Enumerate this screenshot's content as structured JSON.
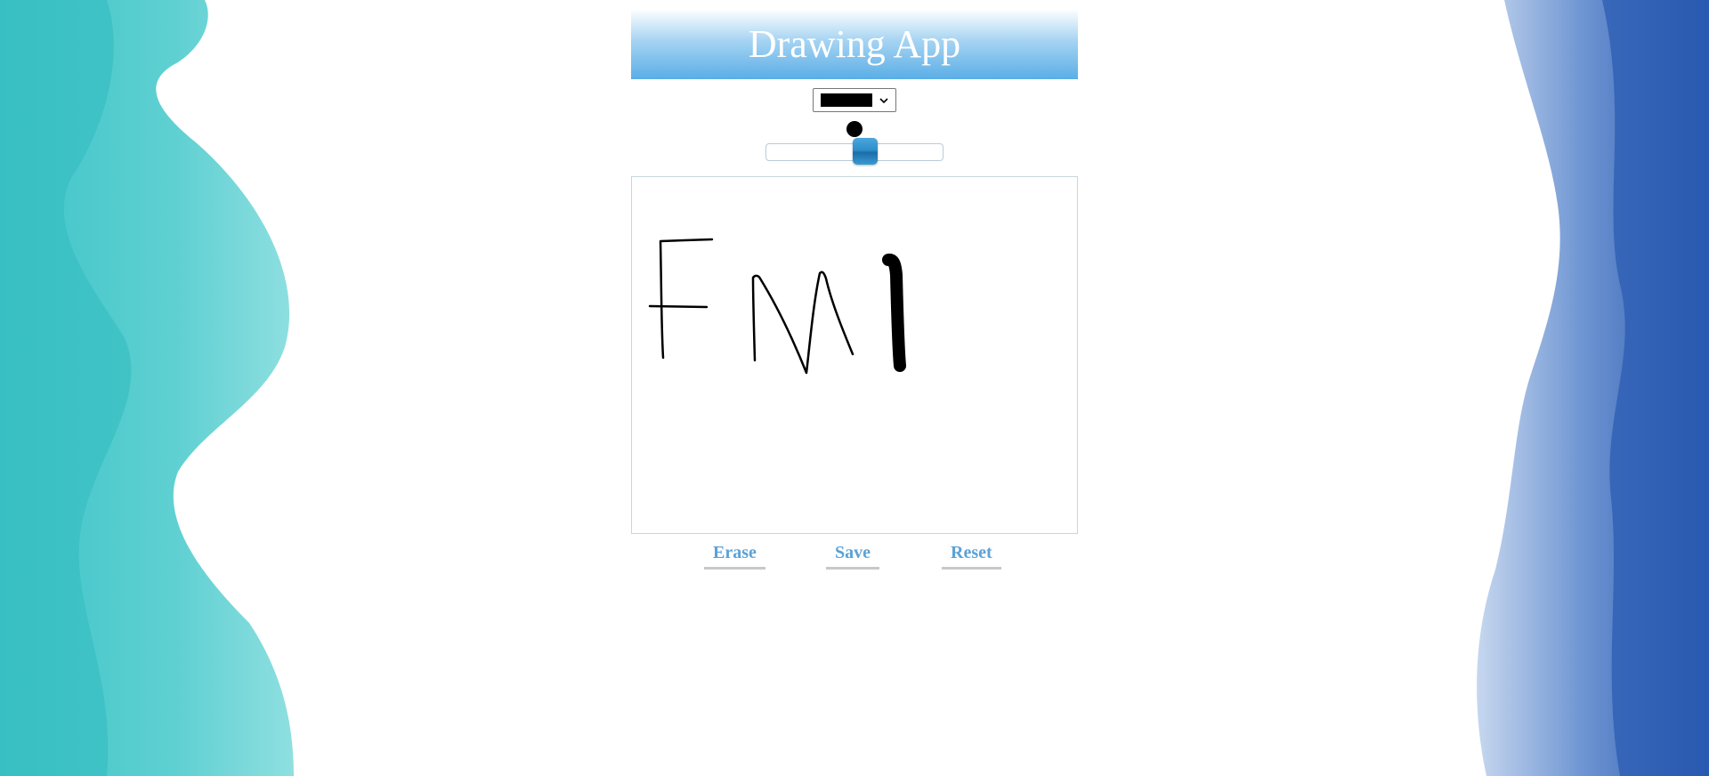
{
  "app": {
    "title": "Drawing App"
  },
  "controls": {
    "color": {
      "selected": "#000000"
    },
    "brush_size": {
      "value_fraction": 0.56
    }
  },
  "buttons": {
    "erase": "Erase",
    "save": "Save",
    "reset": "Reset"
  },
  "colors": {
    "header_gradient_end": "#5aaee6",
    "button_text": "#5aa2d6",
    "slider_thumb": "#2e8fcb",
    "paint_left": "#47c9cc",
    "paint_right": "#2f63b4"
  },
  "icons": {
    "select_arrow": "chevron-down-icon"
  }
}
